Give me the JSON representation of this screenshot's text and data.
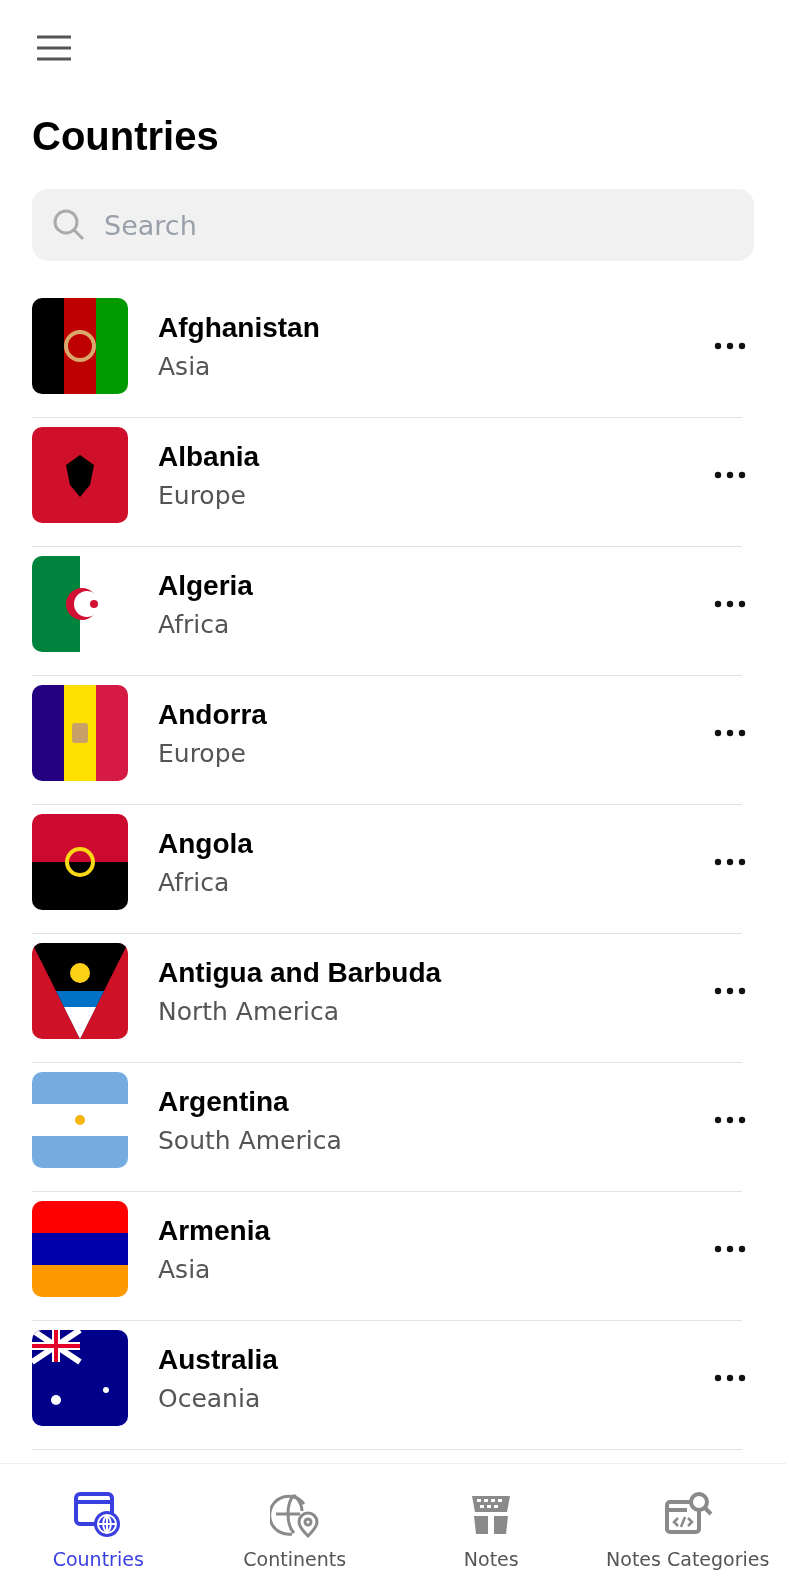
{
  "header": {
    "title": "Countries"
  },
  "search": {
    "placeholder": "Search"
  },
  "countries": [
    {
      "name": "Afghanistan",
      "continent": "Asia"
    },
    {
      "name": "Albania",
      "continent": "Europe"
    },
    {
      "name": "Algeria",
      "continent": "Africa"
    },
    {
      "name": "Andorra",
      "continent": "Europe"
    },
    {
      "name": "Angola",
      "continent": "Africa"
    },
    {
      "name": "Antigua and Barbuda",
      "continent": "North America"
    },
    {
      "name": "Argentina",
      "continent": "South America"
    },
    {
      "name": "Armenia",
      "continent": "Asia"
    },
    {
      "name": "Australia",
      "continent": "Oceania"
    }
  ],
  "tabs": [
    {
      "label": "Countries",
      "selected": true
    },
    {
      "label": "Continents",
      "selected": false
    },
    {
      "label": "Notes",
      "selected": false
    },
    {
      "label": "Notes Categories",
      "selected": false
    }
  ]
}
